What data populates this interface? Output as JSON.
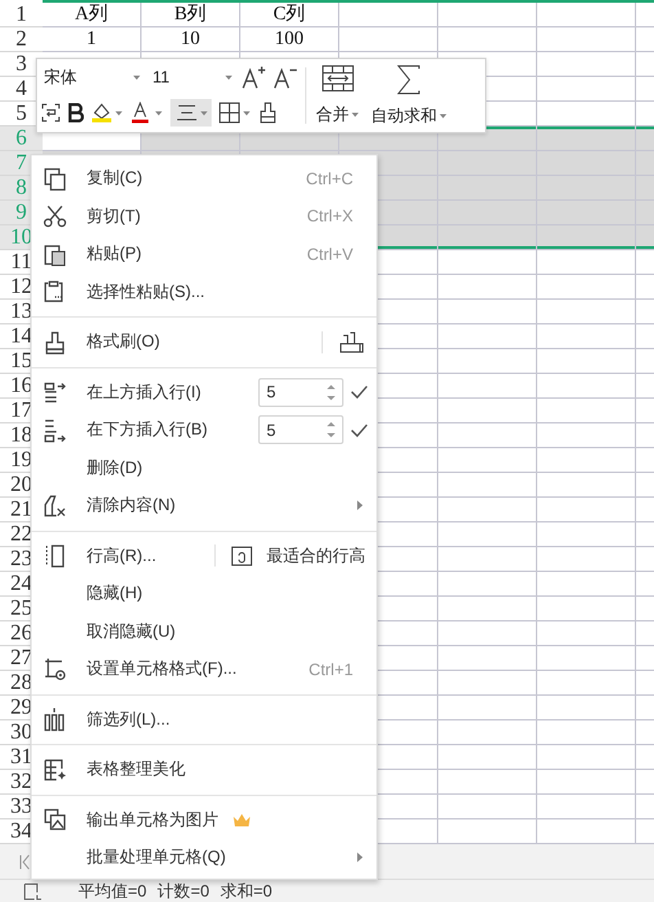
{
  "sheet": {
    "rows": [
      {
        "number": "1",
        "selected": false,
        "cells": [
          "A列",
          "B列",
          "C列"
        ]
      },
      {
        "number": "2",
        "selected": false,
        "cells": [
          "1",
          "10",
          "100"
        ]
      },
      {
        "number": "3",
        "selected": false
      },
      {
        "number": "4",
        "selected": false
      },
      {
        "number": "5",
        "selected": false
      },
      {
        "number": "6",
        "selected": true
      },
      {
        "number": "7",
        "selected": true
      },
      {
        "number": "8",
        "selected": true
      },
      {
        "number": "9",
        "selected": true
      },
      {
        "number": "10",
        "selected": true
      },
      {
        "number": "11",
        "selected": false
      },
      {
        "number": "12",
        "selected": false
      },
      {
        "number": "13",
        "selected": false
      },
      {
        "number": "14",
        "selected": false
      },
      {
        "number": "15",
        "selected": false
      },
      {
        "number": "16",
        "selected": false
      },
      {
        "number": "17",
        "selected": false
      },
      {
        "number": "18",
        "selected": false
      },
      {
        "number": "19",
        "selected": false
      },
      {
        "number": "20",
        "selected": false
      },
      {
        "number": "21",
        "selected": false
      },
      {
        "number": "22",
        "selected": false
      },
      {
        "number": "23",
        "selected": false
      },
      {
        "number": "24",
        "selected": false
      },
      {
        "number": "25",
        "selected": false
      },
      {
        "number": "26",
        "selected": false
      },
      {
        "number": "27",
        "selected": false
      },
      {
        "number": "28",
        "selected": false
      },
      {
        "number": "29",
        "selected": false
      },
      {
        "number": "30",
        "selected": false
      },
      {
        "number": "31",
        "selected": false
      },
      {
        "number": "32",
        "selected": false
      },
      {
        "number": "33",
        "selected": false
      },
      {
        "number": "34",
        "selected": false
      }
    ]
  },
  "mini_toolbar": {
    "font": "宋体",
    "size": "11",
    "align_selected": true,
    "merge_label": "合并",
    "sum_label": "自动求和"
  },
  "context_menu": [
    {
      "kind": "item",
      "label": "复制(C)",
      "shortcut": "Ctrl+C"
    },
    {
      "kind": "item",
      "label": "剪切(T)",
      "shortcut": "Ctrl+X"
    },
    {
      "kind": "item",
      "label": "粘贴(P)",
      "shortcut": "Ctrl+V"
    },
    {
      "kind": "item",
      "label": "选择性粘贴(S)..."
    },
    {
      "kind": "separator"
    },
    {
      "kind": "item",
      "label": "格式刷(O)",
      "side_icon": true
    },
    {
      "kind": "separator"
    },
    {
      "kind": "spinner",
      "label": "在上方插入行(I)",
      "value": "5"
    },
    {
      "kind": "spinner",
      "label": "在下方插入行(B)",
      "value": "5"
    },
    {
      "kind": "item",
      "label": "删除(D)"
    },
    {
      "kind": "item",
      "label": "清除内容(N)",
      "submenu": true
    },
    {
      "kind": "separator"
    },
    {
      "kind": "split",
      "label": "行高(R)...",
      "side_label": "最适合的行高"
    },
    {
      "kind": "item",
      "label": "隐藏(H)"
    },
    {
      "kind": "item",
      "label": "取消隐藏(U)"
    },
    {
      "kind": "item",
      "label": "设置单元格格式(F)...",
      "shortcut": "Ctrl+1"
    },
    {
      "kind": "separator"
    },
    {
      "kind": "item",
      "label": "筛选列(L)..."
    },
    {
      "kind": "separator"
    },
    {
      "kind": "item",
      "label": "表格整理美化"
    },
    {
      "kind": "separator"
    },
    {
      "kind": "item",
      "label": "输出单元格为图片",
      "premium": true
    },
    {
      "kind": "item",
      "label": "批量处理单元格(Q)",
      "submenu": true
    }
  ],
  "status_bar": [
    "平均值=0",
    "计数=0",
    "求和=0"
  ]
}
